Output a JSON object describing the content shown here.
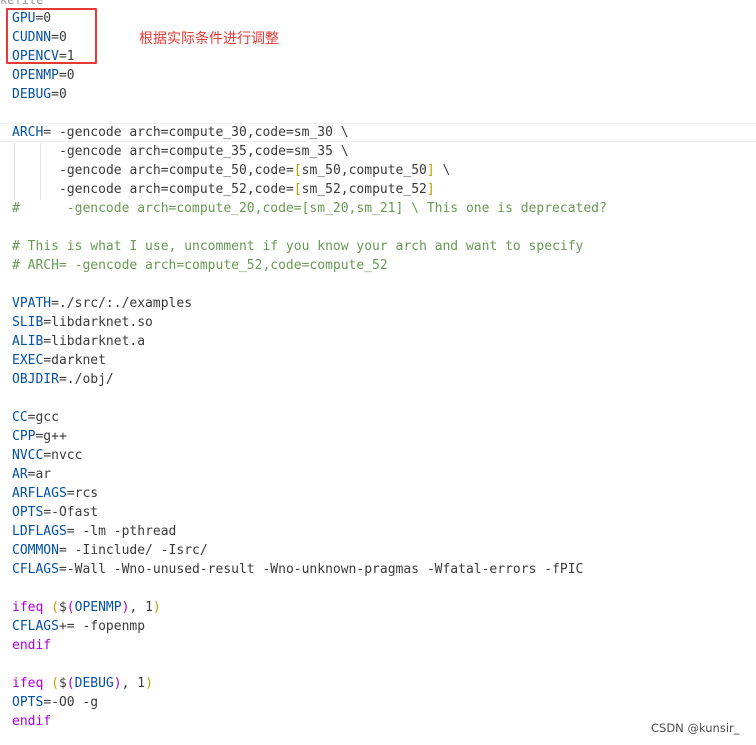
{
  "editor": {
    "top_fragment": "kefile",
    "annotation": "根据实际条件进行调整",
    "watermark": "CSDN @kunsir_",
    "lines": [
      [
        {
          "t": "GPU",
          "c": "var"
        },
        {
          "t": "=0",
          "c": "txt"
        }
      ],
      [
        {
          "t": "CUDNN",
          "c": "var"
        },
        {
          "t": "=0",
          "c": "txt"
        }
      ],
      [
        {
          "t": "OPENCV",
          "c": "var"
        },
        {
          "t": "=1",
          "c": "txt"
        }
      ],
      [
        {
          "t": "OPENMP",
          "c": "var"
        },
        {
          "t": "=0",
          "c": "txt"
        }
      ],
      [
        {
          "t": "DEBUG",
          "c": "var"
        },
        {
          "t": "=0",
          "c": "txt"
        }
      ],
      [],
      [
        {
          "t": "ARCH",
          "c": "var"
        },
        {
          "t": "= -gencode arch=compute_30,code=sm_30 \\",
          "c": "txt"
        }
      ],
      {
        "cont": true,
        "segs": [
          {
            "t": "-gencode arch=compute_35,code=sm_35 \\",
            "c": "txt"
          }
        ]
      },
      {
        "cont": true,
        "segs": [
          {
            "t": "-gencode arch=compute_50,code=",
            "c": "txt"
          },
          {
            "t": "[",
            "c": "br-y"
          },
          {
            "t": "sm_50,compute_50",
            "c": "txt"
          },
          {
            "t": "]",
            "c": "br-y"
          },
          {
            "t": " \\",
            "c": "txt"
          }
        ]
      },
      {
        "cont": true,
        "segs": [
          {
            "t": "-gencode arch=compute_52,code=",
            "c": "txt"
          },
          {
            "t": "[",
            "c": "br-y"
          },
          {
            "t": "sm_52,compute_52",
            "c": "txt"
          },
          {
            "t": "]",
            "c": "br-y"
          }
        ]
      },
      [
        {
          "t": "#      -gencode arch=compute_20,code=[sm_20,sm_21] \\ This one is deprecated?",
          "c": "com"
        }
      ],
      [],
      [
        {
          "t": "# This is what I use, uncomment if you know your arch and want to specify",
          "c": "com"
        }
      ],
      [
        {
          "t": "# ARCH= -gencode arch=compute_52,code=compute_52",
          "c": "com"
        }
      ],
      [],
      [
        {
          "t": "VPATH",
          "c": "var"
        },
        {
          "t": "=./src/:./examples",
          "c": "txt"
        }
      ],
      [
        {
          "t": "SLIB",
          "c": "var"
        },
        {
          "t": "=libdarknet.so",
          "c": "txt"
        }
      ],
      [
        {
          "t": "ALIB",
          "c": "var"
        },
        {
          "t": "=libdarknet.a",
          "c": "txt"
        }
      ],
      [
        {
          "t": "EXEC",
          "c": "var"
        },
        {
          "t": "=darknet",
          "c": "txt"
        }
      ],
      [
        {
          "t": "OBJDIR",
          "c": "var"
        },
        {
          "t": "=./obj/",
          "c": "txt"
        }
      ],
      [],
      [
        {
          "t": "CC",
          "c": "var"
        },
        {
          "t": "=gcc",
          "c": "txt"
        }
      ],
      [
        {
          "t": "CPP",
          "c": "var"
        },
        {
          "t": "=g++",
          "c": "txt"
        }
      ],
      [
        {
          "t": "NVCC",
          "c": "var"
        },
        {
          "t": "=nvcc",
          "c": "txt"
        }
      ],
      [
        {
          "t": "AR",
          "c": "var"
        },
        {
          "t": "=ar",
          "c": "txt"
        }
      ],
      [
        {
          "t": "ARFLAGS",
          "c": "var"
        },
        {
          "t": "=rcs",
          "c": "txt"
        }
      ],
      [
        {
          "t": "OPTS",
          "c": "var"
        },
        {
          "t": "=-Ofast",
          "c": "txt"
        }
      ],
      [
        {
          "t": "LDFLAGS",
          "c": "var"
        },
        {
          "t": "= -lm -pthread",
          "c": "txt"
        }
      ],
      [
        {
          "t": "COMMON",
          "c": "var"
        },
        {
          "t": "= -Iinclude/ -Isrc/",
          "c": "txt"
        }
      ],
      [
        {
          "t": "CFLAGS",
          "c": "var"
        },
        {
          "t": "=-Wall -Wno-unused-result -Wno-unknown-pragmas -Wfatal-errors -fPIC",
          "c": "txt"
        }
      ],
      [],
      [
        {
          "t": "ifeq",
          "c": "kw"
        },
        {
          "t": " ",
          "c": "txt"
        },
        {
          "t": "(",
          "c": "br-y"
        },
        {
          "t": "$",
          "c": "txt"
        },
        {
          "t": "(",
          "c": "br-p"
        },
        {
          "t": "OPENMP",
          "c": "var"
        },
        {
          "t": ")",
          "c": "br-p"
        },
        {
          "t": ", 1",
          "c": "txt"
        },
        {
          "t": ")",
          "c": "br-y"
        }
      ],
      [
        {
          "t": "CFLAGS",
          "c": "var"
        },
        {
          "t": "+= -fopenmp",
          "c": "txt"
        }
      ],
      [
        {
          "t": "endif",
          "c": "kw"
        }
      ],
      [],
      [
        {
          "t": "ifeq",
          "c": "kw"
        },
        {
          "t": " ",
          "c": "txt"
        },
        {
          "t": "(",
          "c": "br-y"
        },
        {
          "t": "$",
          "c": "txt"
        },
        {
          "t": "(",
          "c": "br-p"
        },
        {
          "t": "DEBUG",
          "c": "var"
        },
        {
          "t": ")",
          "c": "br-p"
        },
        {
          "t": ", 1",
          "c": "txt"
        },
        {
          "t": ")",
          "c": "br-y"
        }
      ],
      [
        {
          "t": "OPTS",
          "c": "var"
        },
        {
          "t": "=-O0 -g",
          "c": "txt"
        }
      ],
      [
        {
          "t": "endif",
          "c": "kw"
        }
      ]
    ]
  },
  "colors": {
    "variable": "#0451a5",
    "text": "#3b3b3b",
    "comment": "#6a9955",
    "keyword": "#af00db",
    "bracket": "#b5a400",
    "annotation": "#e53935"
  }
}
